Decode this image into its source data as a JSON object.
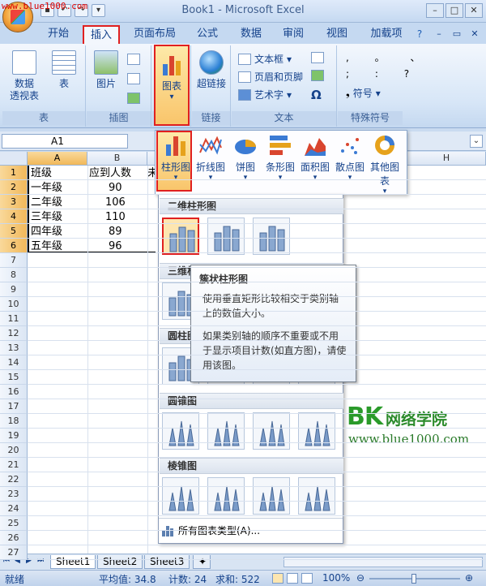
{
  "watermark_top": "www.blue1000.com",
  "window": {
    "title": "Book1 - Microsoft Excel"
  },
  "tabs": [
    {
      "label": "开始",
      "active": false
    },
    {
      "label": "插入",
      "active": true
    },
    {
      "label": "页面布局",
      "active": false
    },
    {
      "label": "公式",
      "active": false
    },
    {
      "label": "数据",
      "active": false
    },
    {
      "label": "审阅",
      "active": false
    },
    {
      "label": "视图",
      "active": false
    },
    {
      "label": "加载项",
      "active": false
    }
  ],
  "ribbon": {
    "groups": {
      "table": "表",
      "illustrations": "插图",
      "charts": "图表",
      "links": "链接",
      "text": "文本",
      "symbols": "特殊符号"
    },
    "pivot_label": "数据\n透视表",
    "table_label": "表",
    "picture_label": "图片",
    "chart_label": "图表",
    "hyperlink_label": "超链接",
    "textbox_label": "文本框",
    "headerfooter_label": "页眉和页脚",
    "wordart_label": "艺术字",
    "symbol_label": "符号"
  },
  "namebox": "A1",
  "columns": [
    "A",
    "B",
    "H"
  ],
  "rows": [
    "1",
    "2",
    "3",
    "4",
    "5",
    "6",
    "7",
    "8",
    "9",
    "10",
    "11",
    "12",
    "13",
    "14",
    "15",
    "16",
    "17",
    "18",
    "19",
    "20",
    "21",
    "22",
    "23",
    "24",
    "25",
    "26",
    "27"
  ],
  "cells": [
    {
      "a": "班级",
      "b": "应到人数",
      "c": "未"
    },
    {
      "a": "一年级",
      "b": "90"
    },
    {
      "a": "二年级",
      "b": "106"
    },
    {
      "a": "三年级",
      "b": "110"
    },
    {
      "a": "四年级",
      "b": "89"
    },
    {
      "a": "五年级",
      "b": "96"
    }
  ],
  "gallery": [
    {
      "label": "柱形图",
      "icon": "column-chart-icon"
    },
    {
      "label": "折线图",
      "icon": "line-chart-icon"
    },
    {
      "label": "饼图",
      "icon": "pie-chart-icon"
    },
    {
      "label": "条形图",
      "icon": "bar-chart-icon"
    },
    {
      "label": "面积图",
      "icon": "area-chart-icon"
    },
    {
      "label": "散点图",
      "icon": "scatter-chart-icon"
    },
    {
      "label": "其他图表",
      "icon": "other-chart-icon"
    }
  ],
  "dropdown": {
    "sections": [
      "二维柱形图",
      "三维柱形图",
      "圆柱图",
      "圆锥图",
      "棱锥图"
    ],
    "all_types": "所有图表类型(A)..."
  },
  "tooltip": {
    "title": "簇状柱形图",
    "p1": "使用垂直矩形比较相交于类别轴上的数值大小。",
    "p2": "如果类别轴的顺序不重要或不用于显示项目计数(如直方图)，请使用该图。"
  },
  "brand": {
    "logo": "BK",
    "name": "网络学院",
    "url": "www.blue1000.com"
  },
  "sheets": [
    "Sheet1",
    "Sheet2",
    "Sheet3"
  ],
  "status": {
    "ready": "就绪",
    "average": "平均值: 34.8",
    "count": "计数: 24",
    "sum": "求和: 522",
    "zoom": "100%"
  },
  "colors": {
    "accent": "#e02020",
    "ribbon": "#c5d9f1",
    "brand": "#2a9a2a"
  }
}
